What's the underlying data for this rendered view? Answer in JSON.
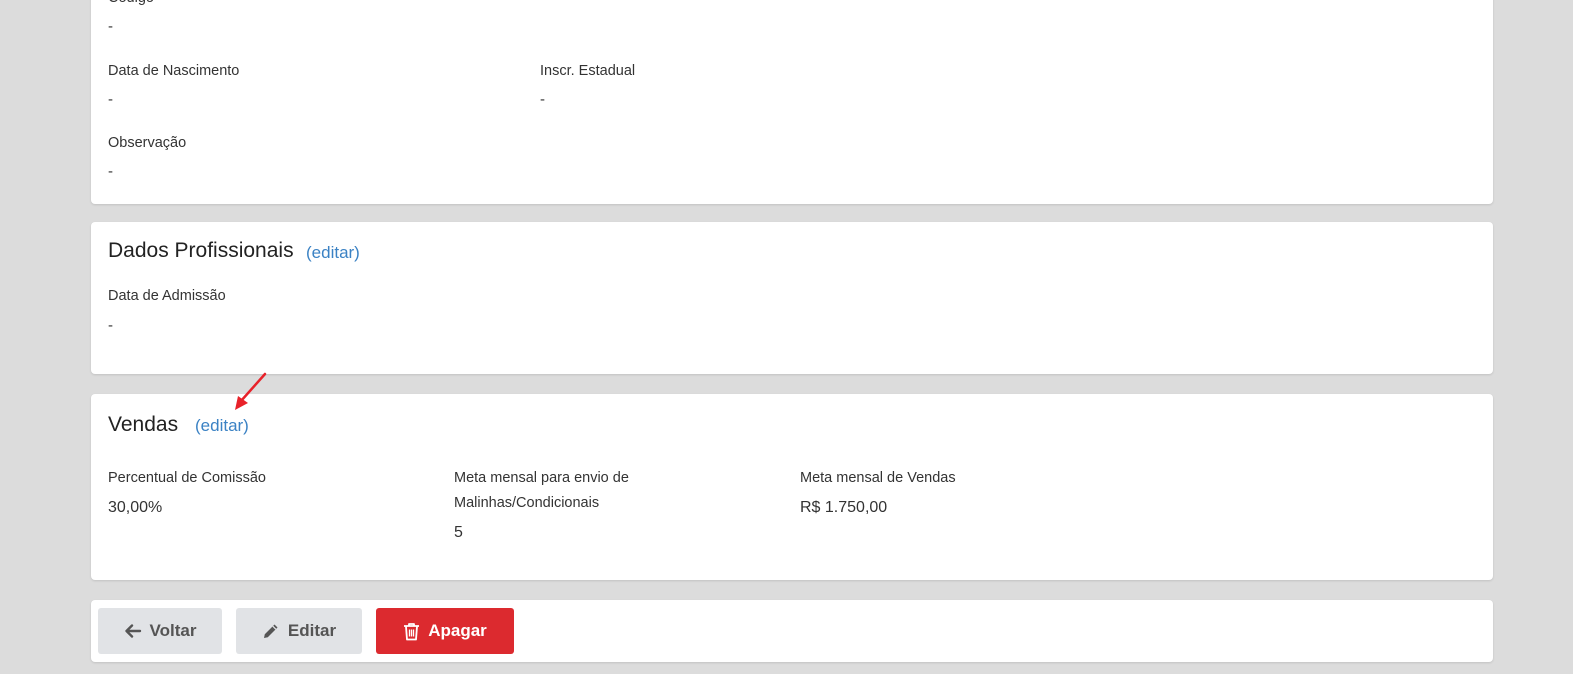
{
  "personal": {
    "codigo_label": "Código",
    "codigo_value": "-",
    "nascimento_label": "Data de Nascimento",
    "nascimento_value": "-",
    "inscr_label": "Inscr. Estadual",
    "inscr_value": "-",
    "obs_label": "Observação",
    "obs_value": "-"
  },
  "profissionais": {
    "title": "Dados Profissionais",
    "edit_label": "(editar)",
    "admissao_label": "Data de Admissão",
    "admissao_value": "-"
  },
  "vendas": {
    "title": "Vendas",
    "edit_label": "(editar)",
    "comissao_label": "Percentual de Comissão",
    "comissao_value": "30,00%",
    "meta_malinhas_label_1": "Meta mensal para envio de",
    "meta_malinhas_label_2": "Malinhas/Condicionais",
    "meta_malinhas_value": "5",
    "meta_vendas_label": "Meta mensal de Vendas",
    "meta_vendas_value": "R$ 1.750,00"
  },
  "actions": {
    "voltar_label": "Voltar",
    "editar_label": "Editar",
    "apagar_label": "Apagar"
  },
  "icons": {
    "voltar": "arrow-left-icon",
    "editar": "pencil-icon",
    "apagar": "trash-icon",
    "annotation": "red-arrow-annotation"
  },
  "colors": {
    "link": "#3b82c4",
    "danger": "#dc2a2f",
    "secondary_button": "#e1e3e6",
    "background": "#dcdcdc"
  }
}
